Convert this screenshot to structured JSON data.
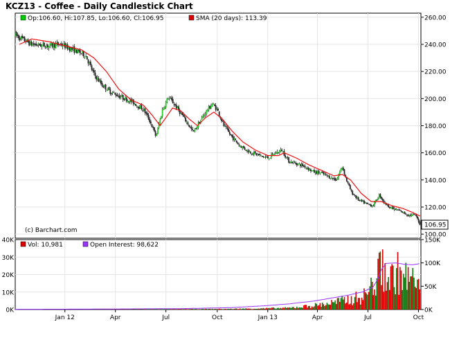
{
  "chart_data": {
    "type": "candlestick",
    "title": "KCZ13 - Coffee - Daily Candlestick Chart",
    "copyright": "(c) Barchart.com",
    "legend_price": {
      "ohlc_text": "Op:106.60, Hi:107.85, Lo:106.60, Cl:106.95",
      "sma_text": "SMA (20 days): 113.39",
      "ohlc_color": "#00cc00",
      "sma_color": "#dd0000"
    },
    "legend_volume": {
      "vol_text": "Vol: 10,981",
      "oi_text": "Open Interest: 98,622",
      "vol_color": "#dd0000",
      "oi_color": "#9933ff"
    },
    "last_price_label": "106.95",
    "last_price": 106.95,
    "price_axis": {
      "ylim": [
        97,
        263
      ],
      "ticks": [
        100,
        120,
        140,
        160,
        180,
        200,
        220,
        240,
        260
      ],
      "tick_labels": [
        "100.00",
        "120.00",
        "140.00",
        "160.00",
        "180.00",
        "200.00",
        "220.00",
        "240.00",
        "260.00"
      ]
    },
    "volume_axis": {
      "left_ylim": [
        0,
        40000
      ],
      "left_ticks": [
        0,
        10000,
        20000,
        30000,
        40000
      ],
      "left_tick_labels": [
        "0K",
        "10K",
        "20K",
        "30K",
        "40K"
      ],
      "right_ylim": [
        0,
        150000
      ],
      "right_ticks": [
        0,
        50000,
        100000,
        150000
      ],
      "right_tick_labels": [
        "0K",
        "50K",
        "100K",
        "150K"
      ]
    },
    "x_axis": {
      "range_days": [
        0,
        490
      ],
      "tick_days": [
        60,
        121,
        182,
        244,
        305,
        365,
        426,
        487
      ],
      "tick_labels": [
        "Jan 12",
        "Apr",
        "Jul",
        "Oct",
        "Jan 13",
        "Apr",
        "Jul",
        "Oct"
      ]
    },
    "price_anchors": [
      [
        0,
        247
      ],
      [
        8,
        244
      ],
      [
        20,
        240
      ],
      [
        40,
        239
      ],
      [
        55,
        240
      ],
      [
        70,
        236
      ],
      [
        85,
        232
      ],
      [
        95,
        218
      ],
      [
        105,
        210
      ],
      [
        115,
        205
      ],
      [
        125,
        202
      ],
      [
        140,
        198
      ],
      [
        155,
        192
      ],
      [
        163,
        183
      ],
      [
        170,
        172
      ],
      [
        178,
        192
      ],
      [
        185,
        201
      ],
      [
        192,
        196
      ],
      [
        200,
        189
      ],
      [
        208,
        182
      ],
      [
        215,
        175
      ],
      [
        222,
        182
      ],
      [
        230,
        190
      ],
      [
        238,
        196
      ],
      [
        244,
        192
      ],
      [
        252,
        180
      ],
      [
        260,
        173
      ],
      [
        270,
        166
      ],
      [
        282,
        161
      ],
      [
        295,
        158
      ],
      [
        305,
        156
      ],
      [
        315,
        160
      ],
      [
        322,
        162
      ],
      [
        330,
        154
      ],
      [
        340,
        152
      ],
      [
        350,
        150
      ],
      [
        360,
        146
      ],
      [
        370,
        145
      ],
      [
        380,
        142
      ],
      [
        388,
        140
      ],
      [
        395,
        150
      ],
      [
        400,
        140
      ],
      [
        406,
        131
      ],
      [
        415,
        125
      ],
      [
        425,
        122
      ],
      [
        432,
        121
      ],
      [
        440,
        129
      ],
      [
        446,
        123
      ],
      [
        455,
        119
      ],
      [
        465,
        117
      ],
      [
        475,
        114
      ],
      [
        483,
        114
      ],
      [
        487,
        110
      ],
      [
        489,
        106.95
      ]
    ],
    "sma_anchors": [
      [
        5,
        240
      ],
      [
        20,
        244
      ],
      [
        40,
        242
      ],
      [
        60,
        239
      ],
      [
        80,
        236
      ],
      [
        95,
        230
      ],
      [
        110,
        220
      ],
      [
        125,
        207
      ],
      [
        140,
        199
      ],
      [
        155,
        195
      ],
      [
        165,
        188
      ],
      [
        175,
        180
      ],
      [
        182,
        186
      ],
      [
        190,
        193
      ],
      [
        200,
        191
      ],
      [
        210,
        185
      ],
      [
        220,
        180
      ],
      [
        230,
        186
      ],
      [
        240,
        190
      ],
      [
        250,
        185
      ],
      [
        262,
        176
      ],
      [
        275,
        168
      ],
      [
        290,
        162
      ],
      [
        305,
        158
      ],
      [
        318,
        158
      ],
      [
        325,
        160
      ],
      [
        340,
        156
      ],
      [
        355,
        151
      ],
      [
        370,
        147
      ],
      [
        385,
        143
      ],
      [
        395,
        144
      ],
      [
        405,
        140
      ],
      [
        418,
        130
      ],
      [
        430,
        124
      ],
      [
        442,
        124
      ],
      [
        455,
        121
      ],
      [
        468,
        119
      ],
      [
        480,
        116
      ],
      [
        489,
        113.39
      ]
    ],
    "volume_anchors": [
      [
        0,
        100
      ],
      [
        100,
        150
      ],
      [
        200,
        250
      ],
      [
        260,
        400
      ],
      [
        300,
        700
      ],
      [
        330,
        1000
      ],
      [
        360,
        2500
      ],
      [
        380,
        4000
      ],
      [
        400,
        6000
      ],
      [
        420,
        8000
      ],
      [
        430,
        14000
      ],
      [
        438,
        20000
      ],
      [
        442,
        30000
      ],
      [
        445,
        26000
      ],
      [
        452,
        18000
      ],
      [
        460,
        24000
      ],
      [
        470,
        20000
      ],
      [
        480,
        19000
      ],
      [
        489,
        10981
      ]
    ],
    "open_interest_anchors": [
      [
        0,
        500
      ],
      [
        100,
        1000
      ],
      [
        200,
        2000
      ],
      [
        260,
        4000
      ],
      [
        300,
        8000
      ],
      [
        330,
        12000
      ],
      [
        360,
        18000
      ],
      [
        380,
        24000
      ],
      [
        400,
        30000
      ],
      [
        420,
        38000
      ],
      [
        432,
        48000
      ],
      [
        438,
        65000
      ],
      [
        442,
        85000
      ],
      [
        448,
        99000
      ],
      [
        460,
        100000
      ],
      [
        470,
        97000
      ],
      [
        480,
        96000
      ],
      [
        489,
        98622
      ]
    ]
  }
}
